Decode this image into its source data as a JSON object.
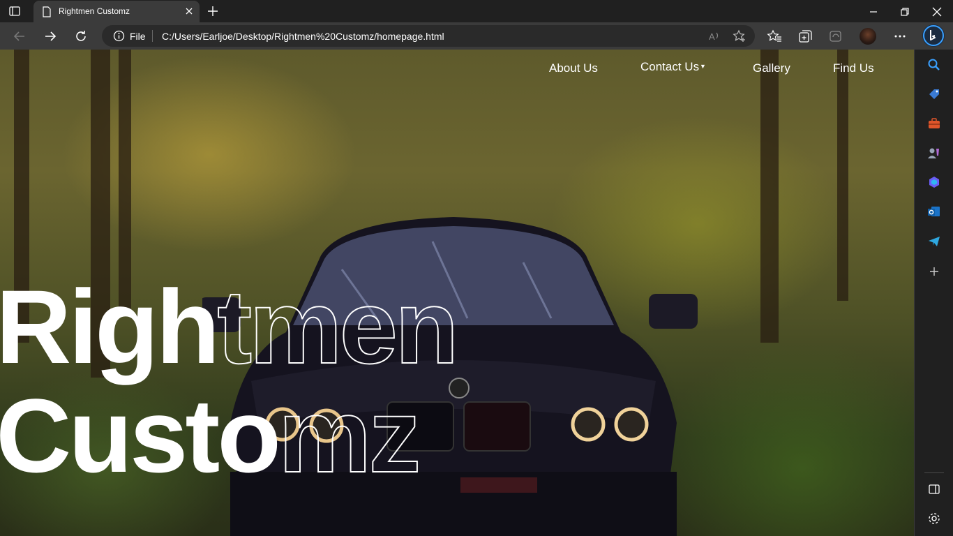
{
  "browser": {
    "tab_title": "Rightmen Customz",
    "address_scheme": "File",
    "url": "C:/Users/Earljoe/Desktop/Rightmen%20Customz/homepage.html"
  },
  "site": {
    "nav": {
      "about": "About Us",
      "contact": "Contact Us",
      "contact_caret": "▼",
      "gallery": "Gallery",
      "find": "Find Us"
    },
    "hero": {
      "line1_solid": "Righ",
      "line1_outline": "tmen",
      "line2_solid": "Custo",
      "line2_outline": "mz"
    }
  },
  "colors": {
    "chrome_bg": "#202020",
    "toolbar_bg": "#3b3b3b",
    "accent_blue": "#3aa0ff",
    "hero_text": "#ffffff"
  },
  "icons": {
    "sidebar": [
      "search-icon",
      "shopping-tag-icon",
      "tools-icon",
      "games-icon",
      "copilot-icon",
      "outlook-icon",
      "telegram-icon",
      "add-icon",
      "sidebar-toggle-icon",
      "settings-icon"
    ]
  }
}
